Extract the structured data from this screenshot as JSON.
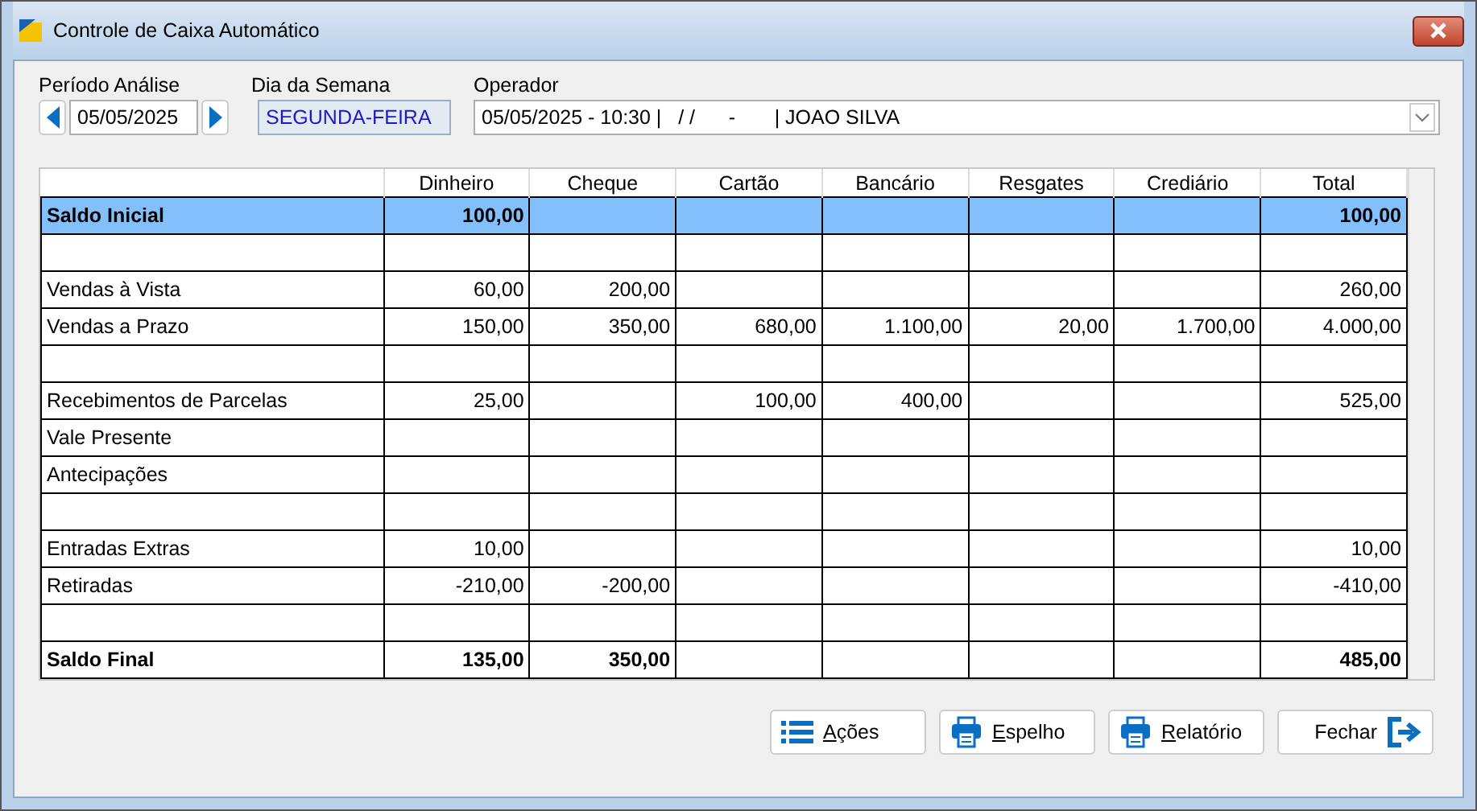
{
  "window": {
    "title": "Controle de Caixa Automático"
  },
  "period": {
    "label": "Período Análise",
    "value": "05/05/2025"
  },
  "weekday": {
    "label": "Dia da Semana",
    "value": "SEGUNDA-FEIRA"
  },
  "operator": {
    "label": "Operador",
    "value": "05/05/2025 - 10:30 |   / /      -       | JOAO SILVA"
  },
  "table": {
    "columns": [
      "Dinheiro",
      "Cheque",
      "Cartão",
      "Bancário",
      "Resgates",
      "Crediário",
      "Total"
    ],
    "rows": [
      {
        "label": "Saldo Inicial",
        "cells": [
          "100,00",
          null,
          null,
          null,
          null,
          null,
          "100,00"
        ],
        "selected": true,
        "bold": true
      },
      {
        "selected": false
      },
      {
        "label": "Vendas à Vista",
        "cells": [
          "60,00",
          "200,00",
          null,
          null,
          null,
          null,
          "260,00"
        ],
        "selected": false,
        "bold": false
      },
      {
        "label": "Vendas a Prazo",
        "cells": [
          "150,00",
          "350,00",
          "680,00",
          "1.100,00",
          "20,00",
          "1.700,00",
          "4.000,00"
        ],
        "selected": false,
        "bold": false
      },
      {
        "selected": false
      },
      {
        "label": "Recebimentos de Parcelas",
        "cells": [
          "25,00",
          null,
          "100,00",
          "400,00",
          null,
          null,
          "525,00"
        ],
        "selected": false,
        "bold": false
      },
      {
        "label": "Vale Presente",
        "cells": [
          null,
          null,
          null,
          null,
          null,
          null,
          null
        ],
        "selected": false,
        "bold": false
      },
      {
        "label": "Antecipações",
        "cells": [
          null,
          null,
          null,
          null,
          null,
          null,
          null
        ],
        "selected": false,
        "bold": false
      },
      {
        "selected": false
      },
      {
        "label": "Entradas Extras",
        "cells": [
          "10,00",
          null,
          null,
          null,
          null,
          null,
          "10,00"
        ],
        "selected": false,
        "bold": false
      },
      {
        "label": "Retiradas",
        "cells": [
          "-210,00",
          "-200,00",
          null,
          null,
          null,
          null,
          "-410,00"
        ],
        "selected": false,
        "bold": false
      },
      {
        "selected": false
      },
      {
        "label": "Saldo Final",
        "cells": [
          "135,00",
          "350,00",
          null,
          null,
          null,
          null,
          "485,00"
        ],
        "selected": false,
        "bold": true
      }
    ]
  },
  "buttons": [
    {
      "kind": "list",
      "label": "Ações",
      "underline_first": true
    },
    {
      "kind": "print",
      "label": "Espelho",
      "underline_first": true
    },
    {
      "kind": "print",
      "label": "Relatório",
      "underline_first": true
    },
    {
      "kind": "exit",
      "label": "Fechar",
      "underline_first": false
    }
  ]
}
